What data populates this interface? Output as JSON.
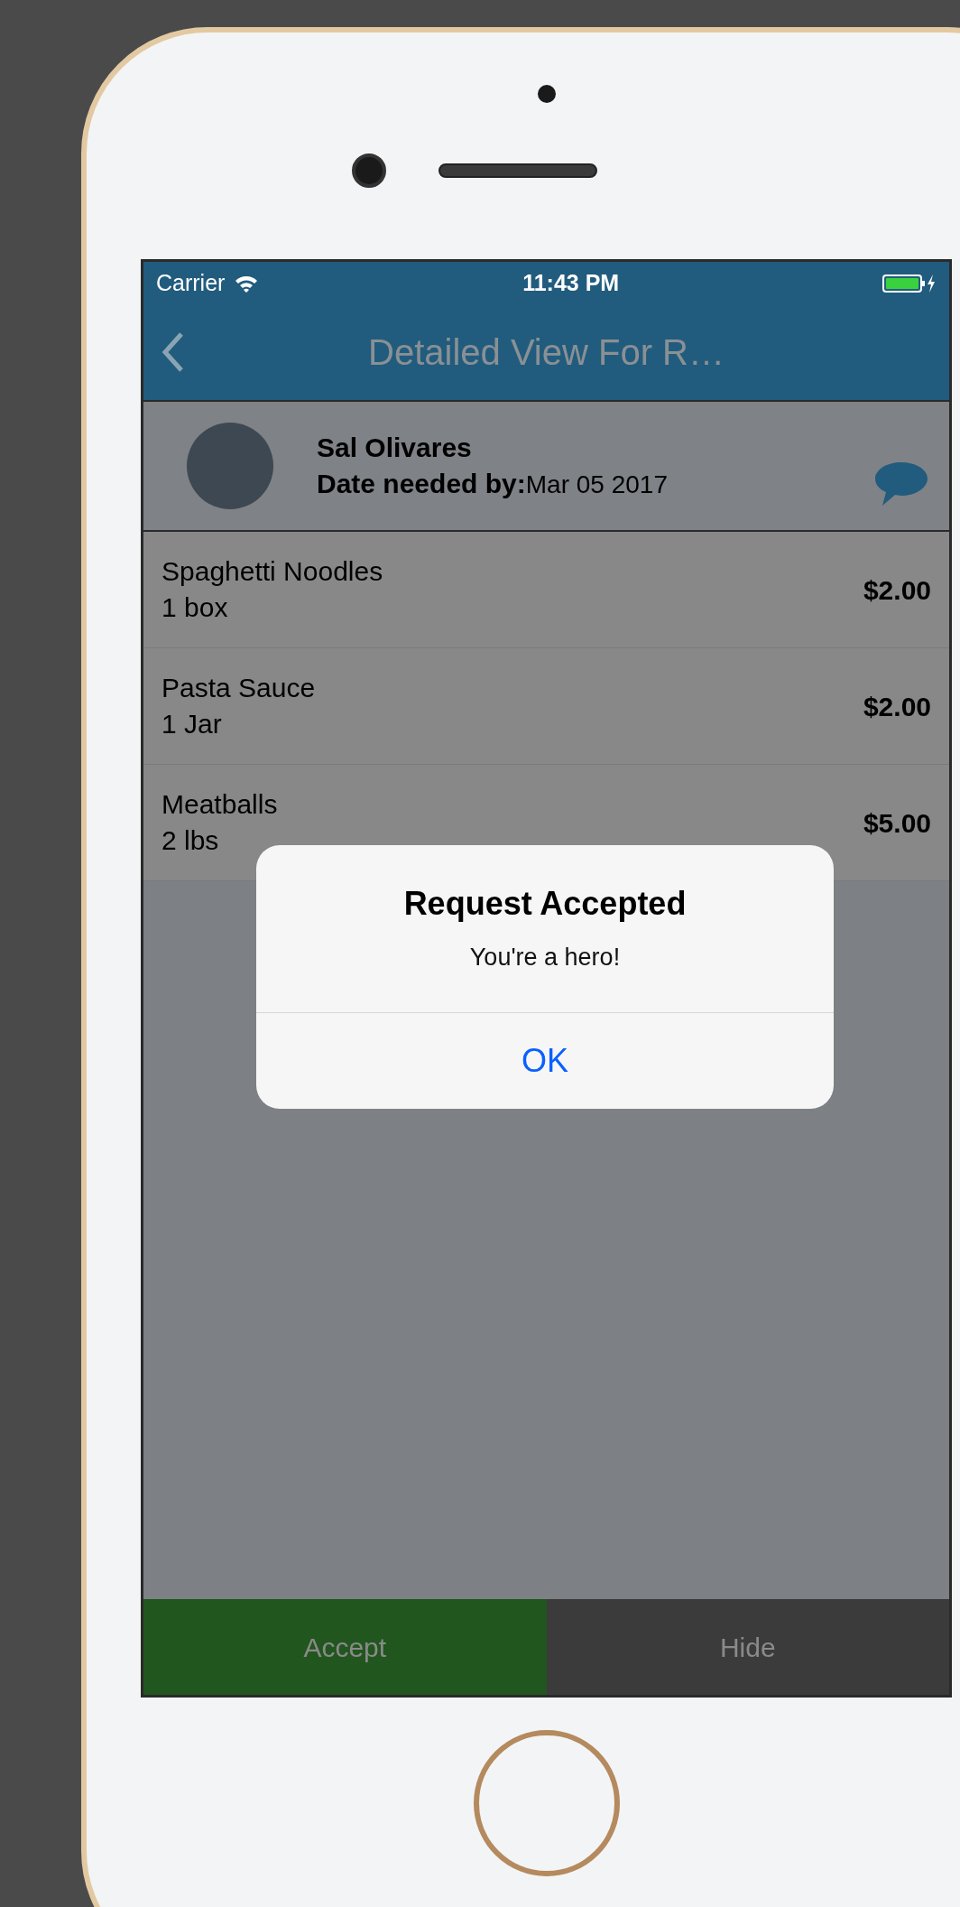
{
  "status_bar": {
    "carrier": "Carrier",
    "time": "11:43 PM"
  },
  "nav_bar": {
    "title": "Detailed View For R…"
  },
  "requester": {
    "name": "Sal Olivares",
    "date_label": "Date needed by:",
    "date": "Mar 05 2017"
  },
  "items": [
    {
      "name": "Spaghetti Noodles",
      "quantity": "1 box",
      "price": "$2.00"
    },
    {
      "name": "Pasta Sauce",
      "quantity": "1 Jar",
      "price": "$2.00"
    },
    {
      "name": "Meatballs",
      "quantity": "2 lbs",
      "price": "$5.00"
    }
  ],
  "alert": {
    "title": "Request Accepted",
    "message": "You're a hero!",
    "button": "OK"
  },
  "actions": [
    {
      "label": "Accept",
      "kind": "accept"
    },
    {
      "label": "Hide",
      "kind": "hide"
    }
  ]
}
